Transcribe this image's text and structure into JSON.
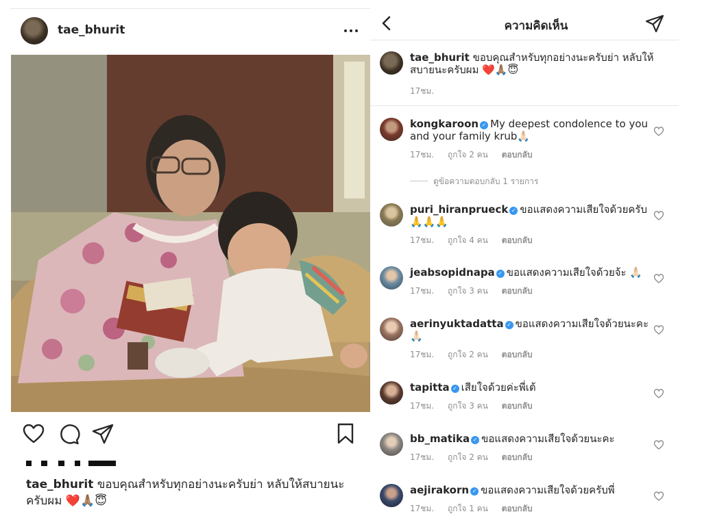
{
  "post": {
    "username": "tae_bhurit",
    "caption": "ขอบคุณสำหรับทุกอย่างนะครับย่า หลับให้สบายนะครับผม ❤️🙏🏽😇"
  },
  "comments_view": {
    "title": "ความคิดเห็น",
    "caption_comment": {
      "username": "tae_bhurit",
      "text": "ขอบคุณสำหรับทุกอย่างนะครับย่า หลับให้สบายนะครับผม ❤️🙏🏽😇",
      "time": "17ชม."
    },
    "view_replies": "ดูข้อความตอบกลับ 1 รายการ",
    "comments": [
      {
        "username": "kongkaroon",
        "text": "My deepest condolence to you and your family krub🙏🏻",
        "time": "17ชม.",
        "likes": "ถูกใจ 2 คน",
        "reply": "ตอบกลับ"
      },
      {
        "username": "puri_hiranprueck",
        "text": "ขอแสดงความเสียใจด้วยครับ 🙏🙏🙏",
        "time": "17ชม.",
        "likes": "ถูกใจ 4 คน",
        "reply": "ตอบกลับ"
      },
      {
        "username": "jeabsopidnapa",
        "text": "ขอแสดงความเสียใจด้วยจ้ะ 🙏🏻",
        "time": "17ชม.",
        "likes": "ถูกใจ 3 คน",
        "reply": "ตอบกลับ"
      },
      {
        "username": "aerinyuktadatta",
        "text": "ขอแสดงความเสียใจด้วยนะคะ 🙏🏻",
        "time": "17ชม.",
        "likes": "ถูกใจ 2 คน",
        "reply": "ตอบกลับ"
      },
      {
        "username": "tapitta",
        "text": "เสียใจด้วยค่ะพี่เต้",
        "time": "17ชม.",
        "likes": "ถูกใจ 3 คน",
        "reply": "ตอบกลับ"
      },
      {
        "username": "bb_matika",
        "text": "ขอแสดงความเสียใจด้วยนะคะ",
        "time": "17ชม.",
        "likes": "ถูกใจ 2 คน",
        "reply": "ตอบกลับ"
      },
      {
        "username": "aejirakorn",
        "text": "ขอแสดงความเสียใจด้วยครับพี่",
        "time": "17ชม.",
        "likes": "ถูกใจ 1 คน",
        "reply": "ตอบกลับ"
      }
    ]
  },
  "icons": [
    "more-icon",
    "heart-icon",
    "comment-icon",
    "share-icon",
    "bookmark-icon",
    "back-arrow-icon",
    "send-icon",
    "verified-badge-icon",
    "small-heart-icon"
  ]
}
